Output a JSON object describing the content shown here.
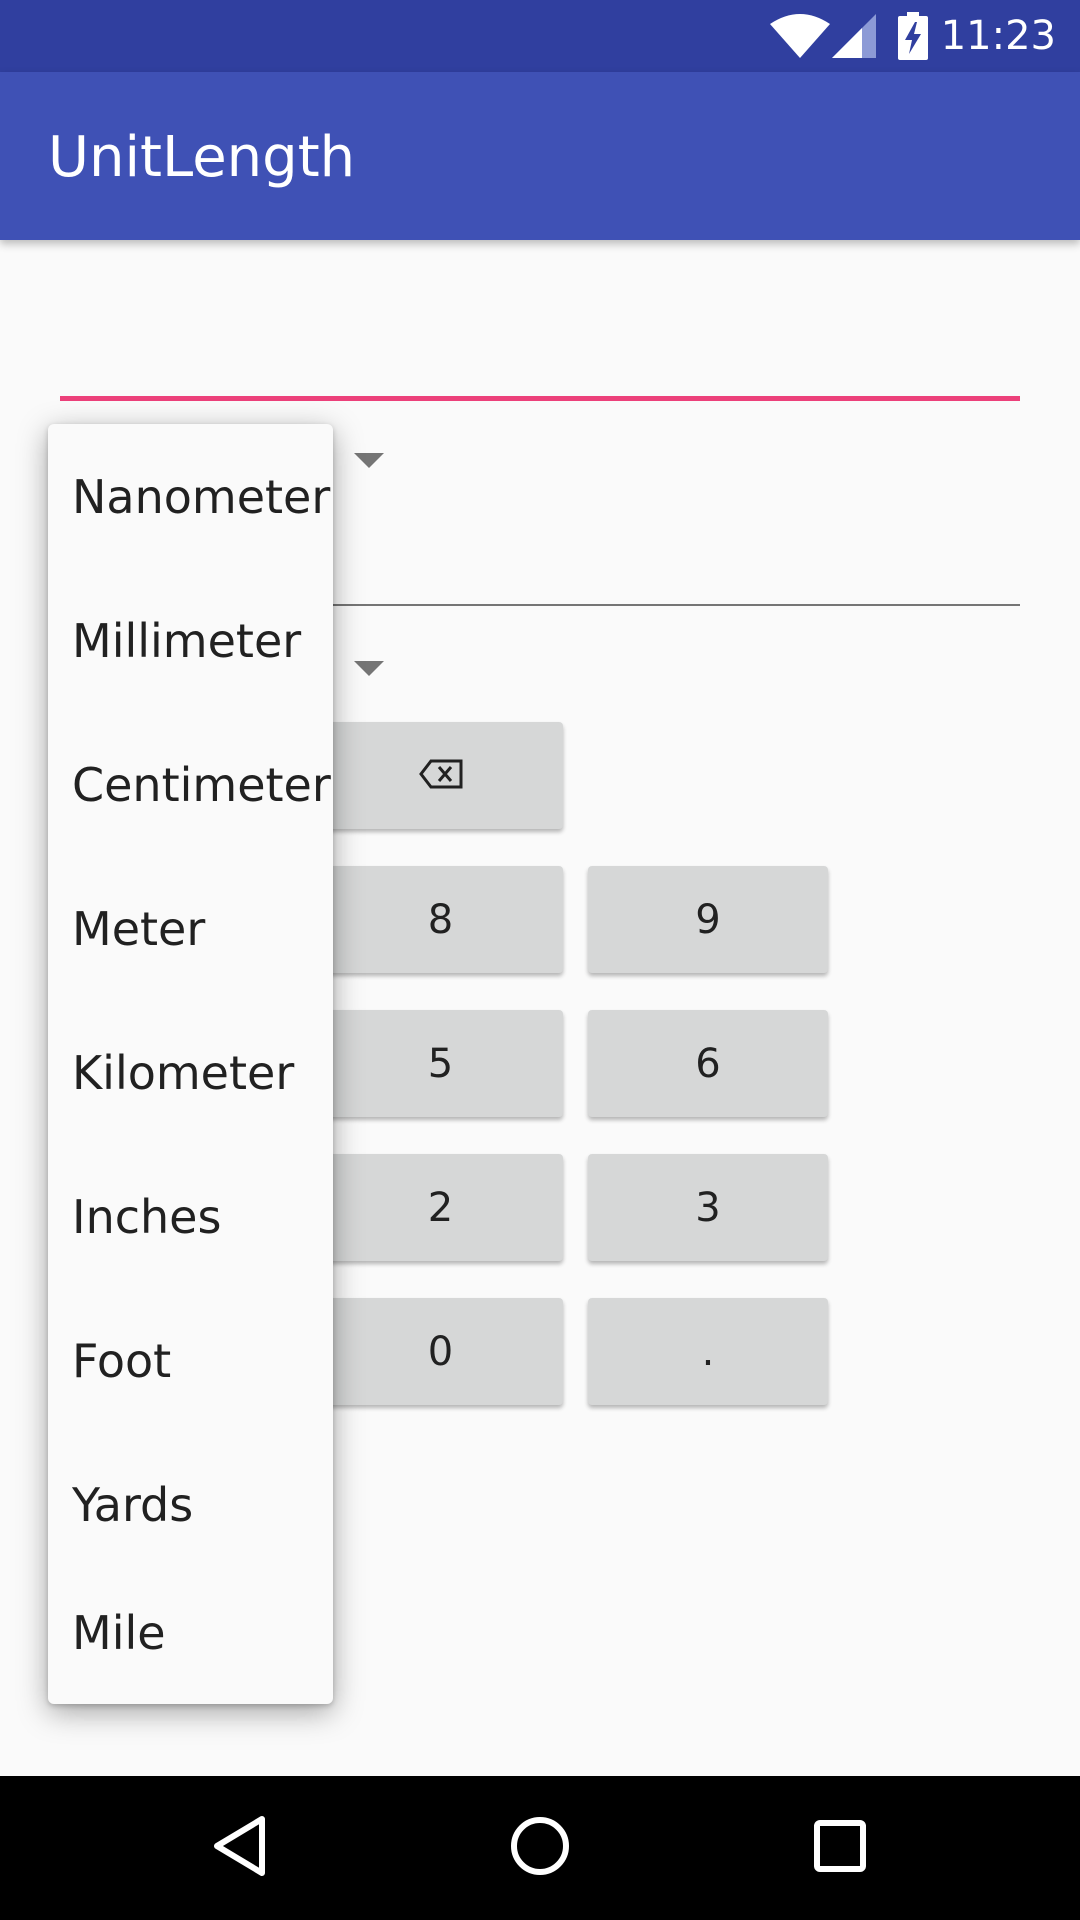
{
  "status_bar": {
    "time": "11:23",
    "icons": [
      "wifi-icon",
      "signal-icon",
      "battery-charging-icon"
    ],
    "background": "#303f9f"
  },
  "app_bar": {
    "title": "UnitLength",
    "background": "#3f51b5"
  },
  "input": {
    "value": "",
    "accent_color": "#ec407a"
  },
  "output": {
    "value": ""
  },
  "keypad": {
    "backspace_icon": "backspace-icon",
    "visible_keys": [
      "8",
      "9",
      "5",
      "6",
      "2",
      "3",
      "0",
      "."
    ]
  },
  "dropdown": {
    "items": [
      "Nanometer",
      "Millimeter",
      "Centimeter",
      "Meter",
      "Kilometer",
      "Inches",
      "Foot",
      "Yards",
      "Mile"
    ]
  },
  "nav_bar": {
    "icons": [
      "back-icon",
      "home-icon",
      "recents-icon"
    ]
  }
}
